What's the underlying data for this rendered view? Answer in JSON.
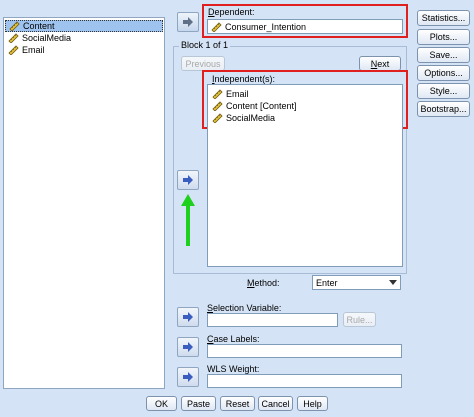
{
  "source_list": {
    "items": [
      {
        "label": "Content",
        "icon": "scale-ruler-icon",
        "selected": true
      },
      {
        "label": "SocialMedia",
        "icon": "scale-ruler-icon",
        "selected": false
      },
      {
        "label": "Email",
        "icon": "scale-ruler-icon",
        "selected": false
      }
    ]
  },
  "dependent": {
    "label": "Dependent:",
    "value": "Consumer_Intention"
  },
  "block": {
    "title": "Block 1 of 1",
    "previous_label": "Previous",
    "next_label": "Next"
  },
  "independents": {
    "label": "Independent(s):",
    "items": [
      "Email",
      "Content [Content]",
      "SocialMedia"
    ]
  },
  "method": {
    "label": "Method:",
    "value": "Enter"
  },
  "selection_variable": {
    "label": "Selection Variable:",
    "rule_label": "Rule..."
  },
  "case_labels": {
    "label": "Case Labels:"
  },
  "wls_weight": {
    "label": "WLS Weight:"
  },
  "side_buttons": [
    "Statistics...",
    "Plots...",
    "Save...",
    "Options...",
    "Style...",
    "Bootstrap..."
  ],
  "bottom_buttons": [
    "OK",
    "Paste",
    "Reset",
    "Cancel",
    "Help"
  ],
  "colors": {
    "background": "#d4e3f5",
    "highlight_red": "#e0201e",
    "annotation_green": "#1fd01f",
    "selection": "#9ec3ee"
  }
}
